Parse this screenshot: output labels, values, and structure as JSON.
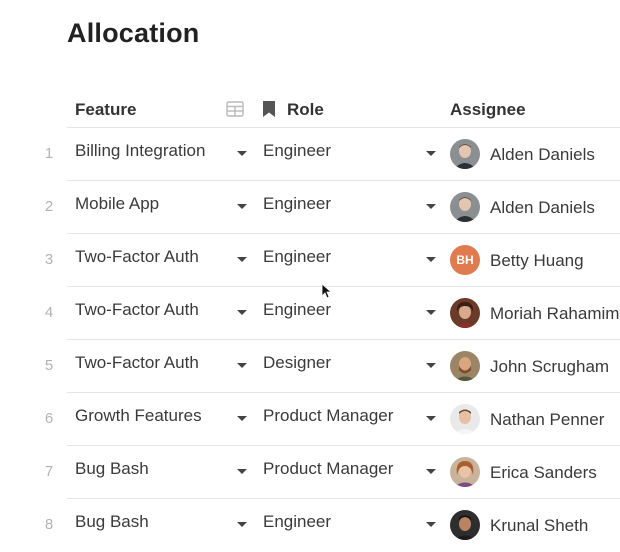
{
  "page": {
    "title": "Allocation"
  },
  "columns": {
    "feature": "Feature",
    "role": "Role",
    "assignee": "Assignee"
  },
  "icons": {
    "table_view": "table-grid-icon",
    "role_column": "bookmark-icon",
    "dropdown": "caret-down-icon"
  },
  "rows": [
    {
      "num": "1",
      "feature": "Billing Integration",
      "role": "Engineer",
      "assignee": "Alden Daniels",
      "avatar": "photo"
    },
    {
      "num": "2",
      "feature": "Mobile App",
      "role": "Engineer",
      "assignee": "Alden Daniels",
      "avatar": "photo"
    },
    {
      "num": "3",
      "feature": "Two-Factor Auth",
      "role": "Engineer",
      "assignee": "Betty Huang",
      "avatar": "initials",
      "initials": "BH"
    },
    {
      "num": "4",
      "feature": "Two-Factor Auth",
      "role": "Engineer",
      "assignee": "Moriah Rahamim",
      "avatar": "photo"
    },
    {
      "num": "5",
      "feature": "Two-Factor Auth",
      "role": "Designer",
      "assignee": "John Scrugham",
      "avatar": "photo"
    },
    {
      "num": "6",
      "feature": "Growth Features",
      "role": "Product Manager",
      "assignee": "Nathan Penner",
      "avatar": "photo"
    },
    {
      "num": "7",
      "feature": "Bug Bash",
      "role": "Product Manager",
      "assignee": "Erica Sanders",
      "avatar": "photo"
    },
    {
      "num": "8",
      "feature": "Bug Bash",
      "role": "Engineer",
      "assignee": "Krunal Sheth",
      "avatar": "photo"
    }
  ],
  "colors": {
    "initials_avatar_bg": "#e07a4f",
    "grid_line": "#e4e4e4",
    "row_number": "#b2b2b2"
  }
}
